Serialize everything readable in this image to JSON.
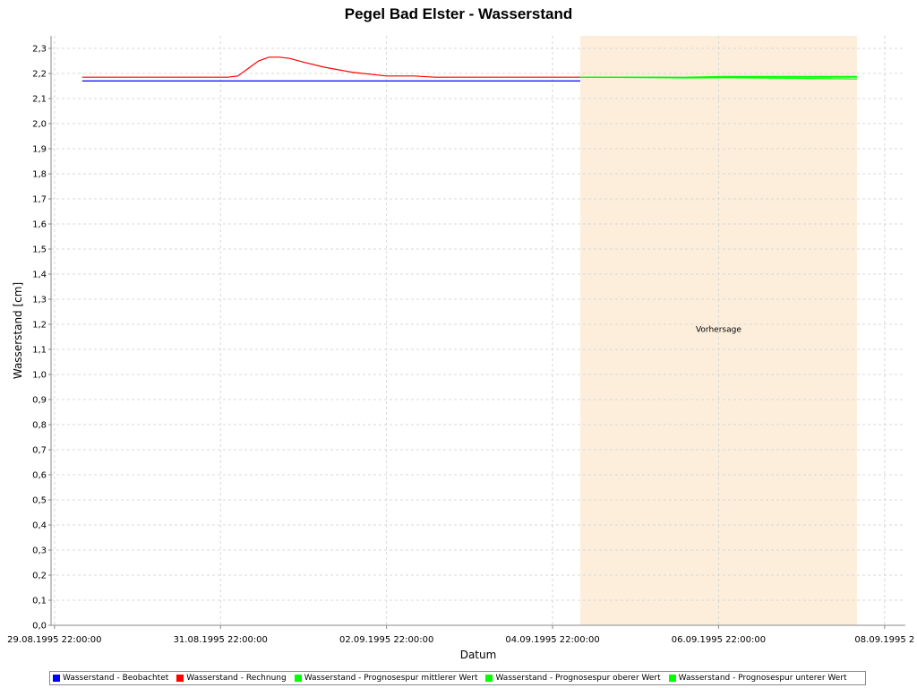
{
  "chart_data": {
    "type": "line",
    "title": "Pegel Bad Elster - Wasserstand",
    "xlabel": "Datum",
    "ylabel": "Wasserstand [cm]",
    "ylim": [
      0.0,
      2.35
    ],
    "xlim": [
      "29.08.1995 21:00",
      "09.09.1995 04:00"
    ],
    "x_ticks": [
      "29.08.1995 22:00:00",
      "31.08.1995 22:00:00",
      "02.09.1995 22:00:00",
      "04.09.1995 22:00:00",
      "06.09.1995 22:00:00",
      "08.09.1995 22:00:00"
    ],
    "x_tick_labels": [
      "29.08.1995 22:00:00",
      "31.08.1995 22:00:00",
      "02.09.1995 22:00:00",
      "04.09.1995 22:00:00",
      "06.09.1995 22:00:00",
      "08.09.1995 2"
    ],
    "y_ticks": [
      "0,0",
      "0,1",
      "0,2",
      "0,3",
      "0,4",
      "0,5",
      "0,6",
      "0,7",
      "0,8",
      "0,9",
      "1,0",
      "1,1",
      "1,2",
      "1,3",
      "1,4",
      "1,5",
      "1,6",
      "1,7",
      "1,8",
      "1,9",
      "2,0",
      "2,1",
      "2,2",
      "2,3"
    ],
    "grid": true,
    "legend_position": "bottom",
    "forecast_region": {
      "start": "05.09.1995 06:00",
      "end": "08.09.1995 14:00",
      "label": "Vorhersage",
      "color": "#fdeedb"
    },
    "series": [
      {
        "name": "Wasserstand - Beobachtet",
        "color": "#0000ff",
        "points": [
          [
            "30.08.1995 06:00",
            2.17
          ],
          [
            "05.09.1995 06:00",
            2.17
          ]
        ]
      },
      {
        "name": "Wasserstand - Rechnung",
        "color": "#ff0000",
        "points": [
          [
            "30.08.1995 06:00",
            2.185
          ],
          [
            "01.09.1995 00:00",
            2.185
          ],
          [
            "01.09.1995 03:00",
            2.19
          ],
          [
            "01.09.1995 06:00",
            2.22
          ],
          [
            "01.09.1995 09:00",
            2.25
          ],
          [
            "01.09.1995 12:00",
            2.265
          ],
          [
            "01.09.1995 15:00",
            2.265
          ],
          [
            "01.09.1995 18:00",
            2.26
          ],
          [
            "01.09.1995 22:00",
            2.245
          ],
          [
            "02.09.1995 04:00",
            2.225
          ],
          [
            "02.09.1995 12:00",
            2.205
          ],
          [
            "02.09.1995 22:00",
            2.19
          ],
          [
            "03.09.1995 06:00",
            2.19
          ],
          [
            "03.09.1995 12:00",
            2.185
          ],
          [
            "05.09.1995 06:00",
            2.185
          ]
        ]
      },
      {
        "name": "Wasserstand - Prognosespur mittlerer Wert",
        "color": "#00ff00",
        "points": [
          [
            "05.09.1995 06:00",
            2.185
          ],
          [
            "06.09.1995 06:00",
            2.185
          ],
          [
            "06.09.1995 12:00",
            2.183
          ],
          [
            "07.09.1995 00:00",
            2.185
          ],
          [
            "08.09.1995 14:00",
            2.185
          ]
        ]
      },
      {
        "name": "Wasserstand - Prognosespur oberer Wert",
        "color": "#00ff00",
        "points": [
          [
            "05.09.1995 06:00",
            2.185
          ],
          [
            "06.09.1995 06:00",
            2.185
          ],
          [
            "06.09.1995 12:00",
            2.185
          ],
          [
            "07.09.1995 00:00",
            2.188
          ],
          [
            "08.09.1995 14:00",
            2.188
          ]
        ]
      },
      {
        "name": "Wasserstand - Prognosespur unterer Wert",
        "color": "#00ff00",
        "points": [
          [
            "05.09.1995 06:00",
            2.185
          ],
          [
            "06.09.1995 06:00",
            2.183
          ],
          [
            "06.09.1995 12:00",
            2.182
          ],
          [
            "07.09.1995 00:00",
            2.183
          ],
          [
            "08.09.1995 01:00",
            2.18
          ],
          [
            "08.09.1995 14:00",
            2.178
          ]
        ]
      }
    ]
  }
}
